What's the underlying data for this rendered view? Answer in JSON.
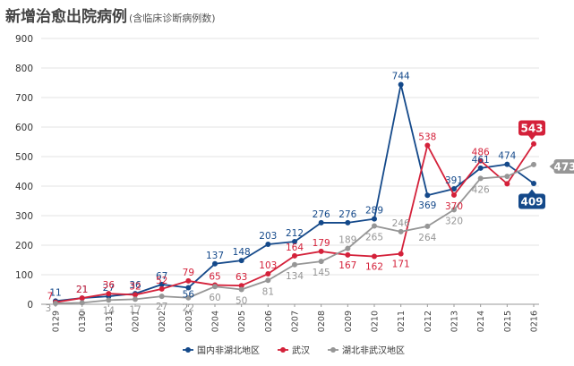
{
  "title": "新增治愈出院病例",
  "subtitle": "(含临床诊断病例数)",
  "chart_data": {
    "type": "line",
    "categories": [
      "0129",
      "0130",
      "0131",
      "0201",
      "0202",
      "0203",
      "0204",
      "0205",
      "0206",
      "0207",
      "0208",
      "0209",
      "0210",
      "0211",
      "0212",
      "0213",
      "0214",
      "0215",
      "0216"
    ],
    "ylim": [
      0,
      900
    ],
    "yticks": [
      0,
      100,
      200,
      300,
      400,
      500,
      600,
      700,
      800,
      900
    ],
    "grid": true,
    "legend_position": "bottom",
    "series": [
      {
        "name": "国内非湖北地区",
        "color": "#14498a",
        "values": [
          11,
          21,
          27,
          36,
          67,
          56,
          137,
          148,
          203,
          212,
          276,
          276,
          289,
          744,
          369,
          391,
          461,
          474,
          409
        ]
      },
      {
        "name": "武汉",
        "color": "#d4213a",
        "values": [
          7,
          21,
          36,
          32,
          52,
          79,
          65,
          63,
          103,
          164,
          179,
          167,
          162,
          171,
          538,
          370,
          486,
          408,
          543
        ]
      },
      {
        "name": "湖北非武汉地区",
        "color": "#969696",
        "values": [
          3,
          5,
          14,
          17,
          27,
          22,
          60,
          50,
          81,
          134,
          145,
          189,
          265,
          246,
          264,
          320,
          426,
          433,
          473
        ]
      }
    ],
    "callouts": [
      {
        "series": 1,
        "value": 543
      },
      {
        "series": 0,
        "value": 409
      },
      {
        "series": 2,
        "value": 473
      }
    ]
  }
}
